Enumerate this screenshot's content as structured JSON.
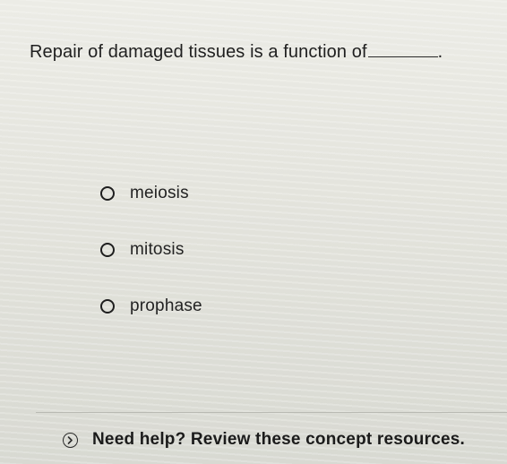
{
  "question": {
    "text": "Repair of damaged tissues is a function of",
    "suffix": "."
  },
  "options": [
    {
      "label": "meiosis",
      "selected": false
    },
    {
      "label": "mitosis",
      "selected": false
    },
    {
      "label": "prophase",
      "selected": false
    }
  ],
  "help": {
    "icon": "chevron-right-circle-icon",
    "text": "Need help? Review these concept resources."
  }
}
